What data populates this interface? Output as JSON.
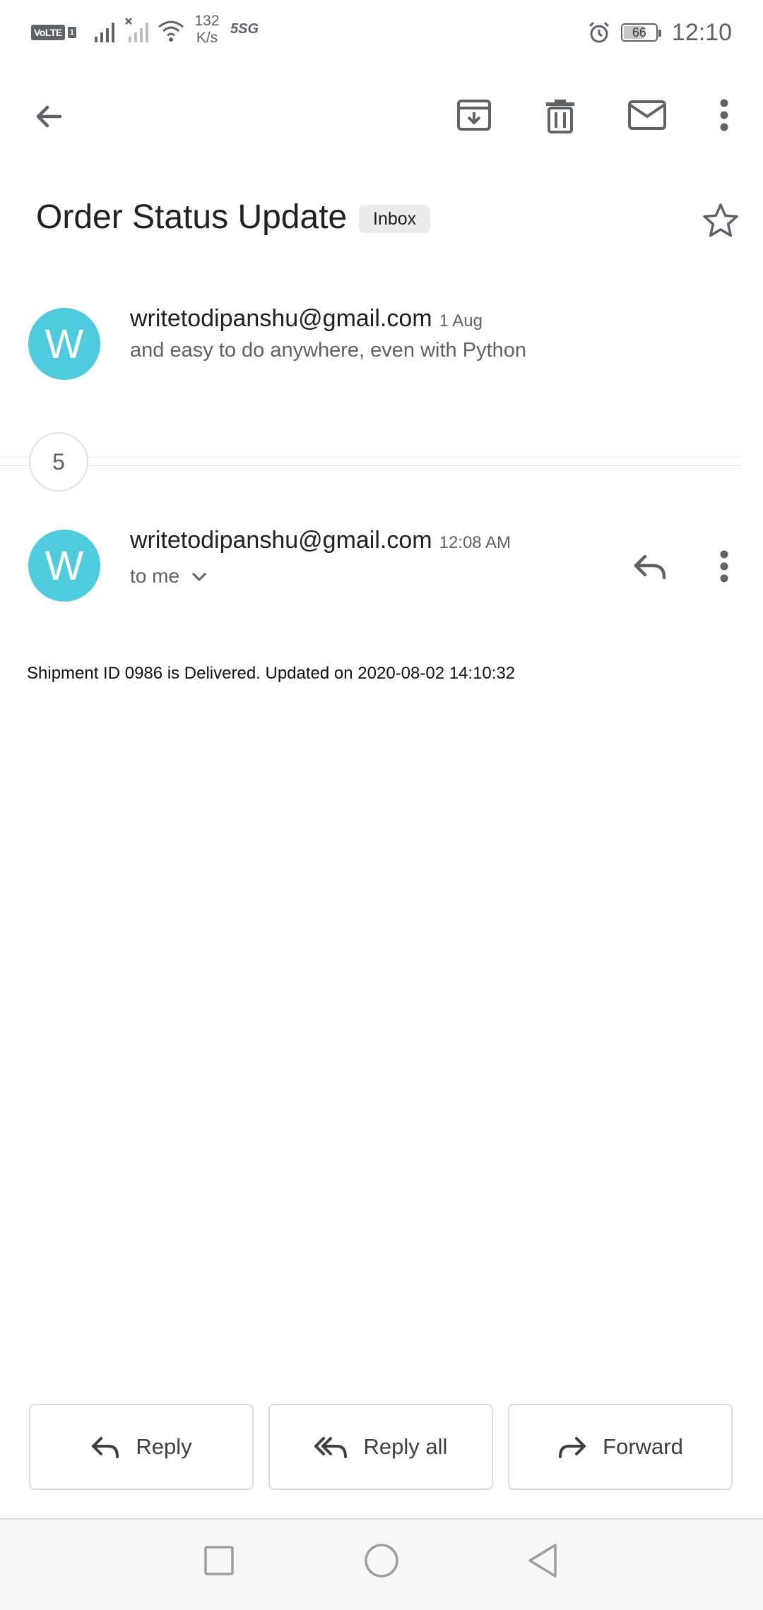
{
  "status_bar": {
    "volte": "VoLTE",
    "sim": "1",
    "speed_value": "132",
    "speed_unit": "K/s",
    "network": "5SG",
    "battery": "66",
    "battery_level": 0.66,
    "time": "12:10"
  },
  "app_bar": {
    "icons": [
      "back-arrow-icon",
      "archive-icon",
      "delete-icon",
      "mark-unread-icon",
      "more-vert-icon"
    ]
  },
  "subject": {
    "title": "Order Status Update",
    "label": "Inbox"
  },
  "collapsed_message": {
    "avatar_letter": "W",
    "sender": "writetodipanshu@gmail.com",
    "date": "1 Aug",
    "snippet": "and easy to do anywhere, even with Python"
  },
  "hidden_count": "5",
  "expanded_message": {
    "avatar_letter": "W",
    "sender": "writetodipanshu@gmail.com",
    "time": "12:08 AM",
    "recipient": "to me",
    "body": "Shipment ID 0986 is Delivered. Updated on 2020-08-02 14:10:32"
  },
  "actions": {
    "reply": "Reply",
    "reply_all": "Reply all",
    "forward": "Forward"
  },
  "colors": {
    "avatar": "#4ecbdc",
    "icon": "#5f6368"
  }
}
